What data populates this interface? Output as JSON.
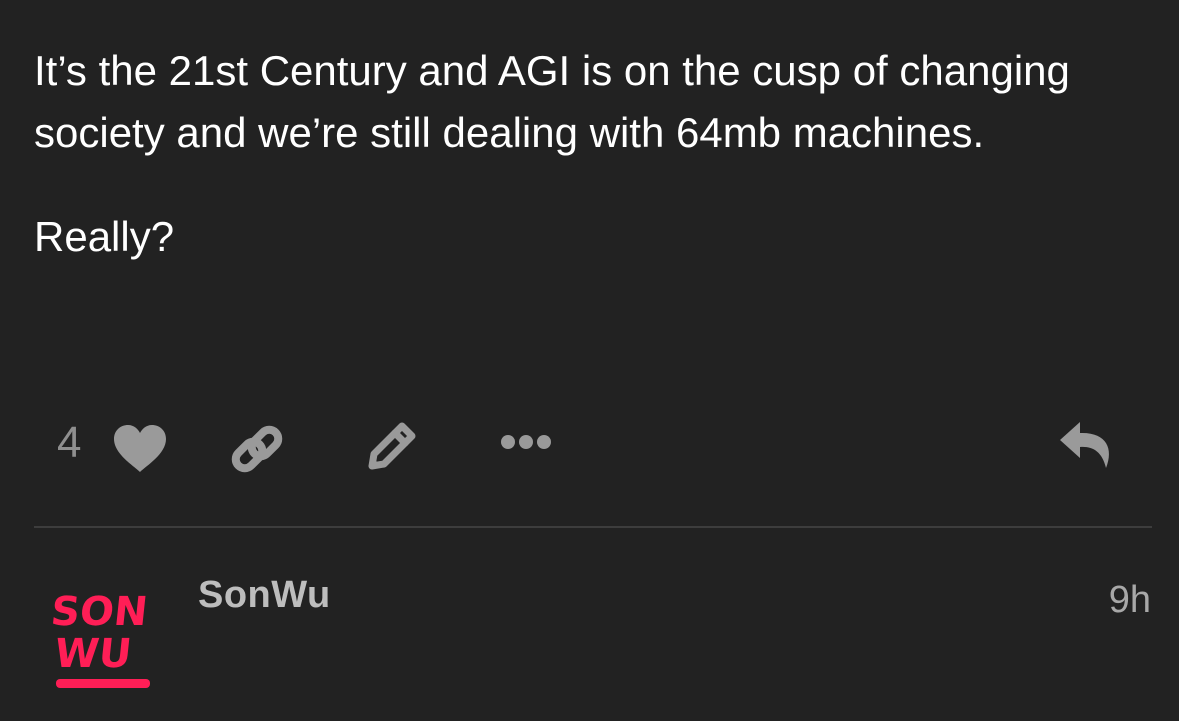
{
  "post": {
    "paragraphs": [
      "It’s the 21st Century and AGI is on the cusp of changing society and we’re still dealing with 64mb machines.",
      "Really?"
    ]
  },
  "actions": {
    "like_count": "4",
    "icons": [
      "heart-icon",
      "link-icon",
      "pencil-icon",
      "more-icon",
      "reply-icon"
    ],
    "icon_color": "#9a9a9a"
  },
  "author": {
    "username": "SonWu",
    "time": "9h",
    "avatar_text": [
      "SON",
      "WU"
    ],
    "avatar_color": "#ff1e56"
  },
  "colors": {
    "background": "#222222",
    "text": "#ffffff",
    "divider": "#3d3d3d"
  }
}
